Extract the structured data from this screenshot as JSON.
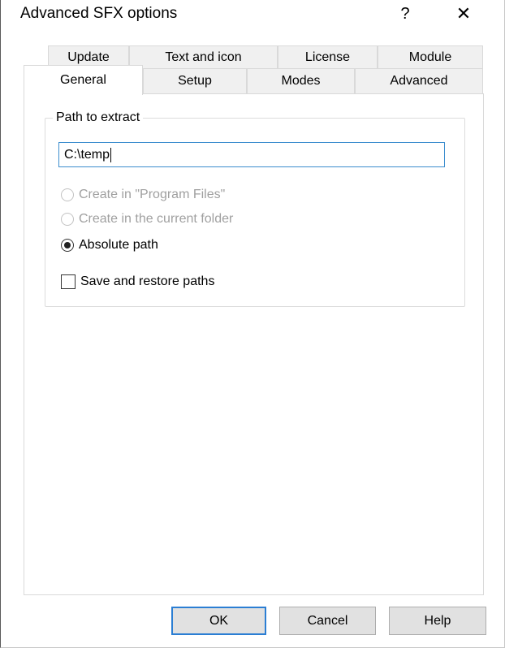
{
  "window": {
    "title": "Advanced SFX options",
    "help_glyph": "?",
    "close_glyph": "✕"
  },
  "tabs": {
    "row1": [
      "Update",
      "Text and icon",
      "License",
      "Module"
    ],
    "row2": [
      "General",
      "Setup",
      "Modes",
      "Advanced"
    ],
    "active": "General"
  },
  "general": {
    "group_label": "Path to extract",
    "path_value": "C:\\temp",
    "options": [
      {
        "label": "Create in \"Program Files\"",
        "checked": false,
        "enabled": false
      },
      {
        "label": "Create in the current folder",
        "checked": false,
        "enabled": false
      },
      {
        "label": "Absolute path",
        "checked": true,
        "enabled": true
      }
    ],
    "save_restore_label": "Save and restore paths",
    "save_restore_checked": false
  },
  "buttons": {
    "ok": "OK",
    "cancel": "Cancel",
    "help": "Help"
  },
  "colors": {
    "focus_border": "#3c8dce",
    "default_button_border": "#2b7ed3",
    "disabled_text": "#a0a0a0"
  }
}
